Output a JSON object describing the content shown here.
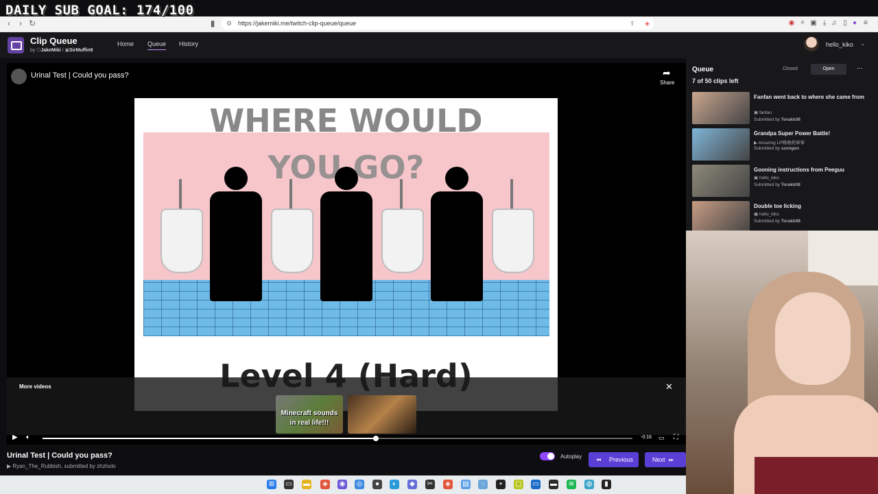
{
  "overlay": {
    "goal": "DAILY SUB GOAL: 174/100"
  },
  "browser": {
    "url": "https://jakemiki.me/twitch-clip-queue/queue"
  },
  "app": {
    "title": "Clip Queue",
    "by_prefix": "by",
    "author1": "JakeMiki",
    "separator": "/",
    "author2": "SirMuffin9",
    "nav": {
      "home": "Home",
      "queue": "Queue",
      "history": "History"
    },
    "user": "hello_kiko"
  },
  "player": {
    "video_title": "Urinal Test | Could you pass?",
    "share": "Share",
    "slide": {
      "line1": "WHERE WOULD",
      "line2": "YOU GO?",
      "level": "Level 4 (Hard)"
    },
    "more_videos": "More videos",
    "thumb_mc_line1": "Minecraft sounds",
    "thumb_mc_line2": "in real life!!!",
    "time": "-0:16",
    "progress": 0.565
  },
  "clip": {
    "title": "Urinal Test | Could you pass?",
    "channel": "Ryan_The_Rubbish",
    "submitted": ", submitted by",
    "submitter": "zhzholo",
    "autoplay": "Autoplay",
    "previous": "Previous",
    "next": "Next"
  },
  "queue": {
    "heading": "Queue",
    "count": "7 of 50 clips left",
    "closed": "Closed",
    "open": "Open",
    "items": [
      {
        "title": "Fanfan went back to where she came from",
        "channel": "fanfan",
        "submitted_prefix": "Submitted by",
        "submitter": "Torakk08",
        "color": "#c9a68f"
      },
      {
        "title": "Grandpa Super Power Battle!",
        "channel": "Amazing LP特奇的爷爷",
        "submitted_prefix": "Submitted by",
        "submitter": "szongen",
        "color": "#7fb6d9"
      },
      {
        "title": "Gooning instructions from Peeguu",
        "channel": "hello_kiko",
        "submitted_prefix": "Submitted by",
        "submitter": "Torakk08",
        "color": "#8e8a7a"
      },
      {
        "title": "Double toe licking",
        "channel": "hello_kiko",
        "submitted_prefix": "Submitted by",
        "submitter": "Torakk08",
        "color": "#c79c84"
      }
    ]
  },
  "colors": {
    "accent": "#9147ff",
    "button": "#5a3fd6",
    "bg": "#0e0e10"
  }
}
